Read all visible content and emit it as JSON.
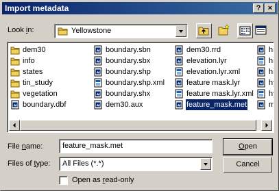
{
  "window": {
    "title": "Import metadata",
    "help_label": "?",
    "close_label": "×"
  },
  "lookin": {
    "label_pre": "Look ",
    "label_key": "i",
    "label_post": "n:",
    "value": "Yellowstone"
  },
  "files": [
    {
      "name": "dem30",
      "icon": "folder-icon"
    },
    {
      "name": "info",
      "icon": "folder-icon"
    },
    {
      "name": "states",
      "icon": "folder-icon"
    },
    {
      "name": "tin_study",
      "icon": "folder-icon"
    },
    {
      "name": "vegetation",
      "icon": "folder-icon"
    },
    {
      "name": "boundary.dbf",
      "icon": "file-icon"
    },
    {
      "name": "boundary.sbn",
      "icon": "file-icon"
    },
    {
      "name": "boundary.sbx",
      "icon": "file-icon"
    },
    {
      "name": "boundary.shp",
      "icon": "file-icon"
    },
    {
      "name": "boundary.shp.xml",
      "icon": "xml-icon"
    },
    {
      "name": "boundary.shx",
      "icon": "file-icon"
    },
    {
      "name": "dem30.aux",
      "icon": "file-icon"
    },
    {
      "name": "dem30.rrd",
      "icon": "file-icon"
    },
    {
      "name": "elevation.lyr",
      "icon": "file-icon"
    },
    {
      "name": "elevation.lyr.xml",
      "icon": "xml-icon"
    },
    {
      "name": "feature mask.lyr",
      "icon": "file-icon"
    },
    {
      "name": "feature mask.lyr.xml",
      "icon": "xml-icon"
    },
    {
      "name": "feature_mask.met",
      "icon": "file-icon",
      "selected": true
    },
    {
      "name": "hills",
      "icon": "file-icon"
    },
    {
      "name": "hills",
      "icon": "xml-icon"
    },
    {
      "name": "hills",
      "icon": "file-icon"
    },
    {
      "name": "hyd",
      "icon": "file-icon"
    },
    {
      "name": "hyd",
      "icon": "xml-icon"
    },
    {
      "name": "mas",
      "icon": "file-icon"
    }
  ],
  "filename": {
    "label_pre": "File ",
    "label_key": "n",
    "label_post": "ame:",
    "value": "feature_mask.met"
  },
  "filetype": {
    "label_pre": "Files of ",
    "label_key": "t",
    "label_post": "ype:",
    "value": "All Files (*.*)"
  },
  "open_button": {
    "key": "O",
    "rest": "pen"
  },
  "cancel_button": {
    "label": "Cancel"
  },
  "readonly": {
    "pre": "Open as ",
    "key": "r",
    "post": "ead-only",
    "checked": false
  },
  "colors": {
    "title_bar": "#0a246a",
    "selection": "#0a246a",
    "face": "#d4d0c8"
  }
}
